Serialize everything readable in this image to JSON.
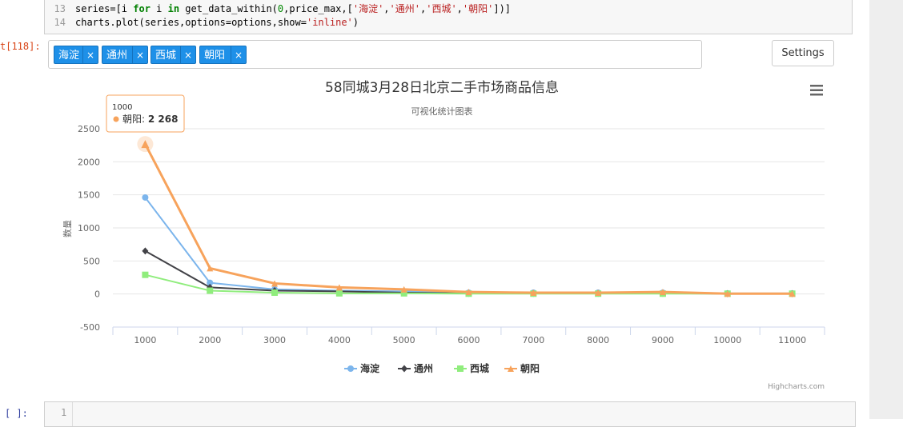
{
  "notebook": {
    "code_lines": [
      {
        "num": "13",
        "tokens": [
          [
            "",
            "series=[i "
          ],
          [
            "kw",
            "for"
          ],
          [
            "",
            " i "
          ],
          [
            "kw",
            "in"
          ],
          [
            "",
            " get_data_within("
          ],
          [
            "num",
            "0"
          ],
          [
            "",
            ",price_max,["
          ],
          [
            "str",
            "'海淀'"
          ],
          [
            "",
            ","
          ],
          [
            "str",
            "'通州'"
          ],
          [
            "",
            ","
          ],
          [
            "str",
            "'西城'"
          ],
          [
            "",
            ","
          ],
          [
            "str",
            "'朝阳'"
          ],
          [
            "",
            "])]"
          ]
        ]
      },
      {
        "num": "14",
        "tokens": [
          [
            "",
            "charts.plot(series,options=options,show="
          ],
          [
            "str",
            "'inline'"
          ],
          [
            "",
            ")"
          ]
        ]
      }
    ],
    "output_prompt": "t[118]:",
    "next_prompt": "[ ]:",
    "next_line_number": "1"
  },
  "selector": {
    "tags": [
      "海淀",
      "通州",
      "西城",
      "朝阳"
    ],
    "remove_symbol": "×"
  },
  "settings_label": "Settings",
  "colors": {
    "haidian": "#7cb5ec",
    "tongzhou": "#434348",
    "xicheng": "#90ed7d",
    "chaoyang": "#f7a35c",
    "tag_bg": "#1e90e8"
  },
  "chart_data": {
    "type": "line",
    "title": "58同城3月28日北京二手市场商品信息",
    "subtitle": "可视化统计图表",
    "ylabel": "数量",
    "xlabel": "",
    "x": [
      1000,
      2000,
      3000,
      4000,
      5000,
      6000,
      7000,
      8000,
      9000,
      10000,
      11000
    ],
    "ylim": [
      -500,
      2500
    ],
    "yticks": [
      -500,
      0,
      500,
      1000,
      1500,
      2000,
      2500
    ],
    "grid": true,
    "legend_position": "bottom-center",
    "credits": "Highcharts.com",
    "series": [
      {
        "name": "海淀",
        "marker": "circle",
        "values": [
          1460,
          170,
          70,
          50,
          40,
          20,
          20,
          20,
          20,
          10,
          10
        ]
      },
      {
        "name": "通州",
        "marker": "diamond",
        "values": [
          650,
          100,
          50,
          40,
          20,
          10,
          10,
          10,
          10,
          5,
          5
        ]
      },
      {
        "name": "西城",
        "marker": "square",
        "values": [
          290,
          50,
          20,
          10,
          10,
          5,
          5,
          5,
          5,
          5,
          5
        ]
      },
      {
        "name": "朝阳",
        "marker": "triangle",
        "values": [
          2268,
          390,
          160,
          100,
          70,
          30,
          20,
          20,
          30,
          5,
          5
        ]
      }
    ],
    "tooltip": {
      "x": "1000",
      "series": "朝阳",
      "value": "2 268"
    }
  }
}
